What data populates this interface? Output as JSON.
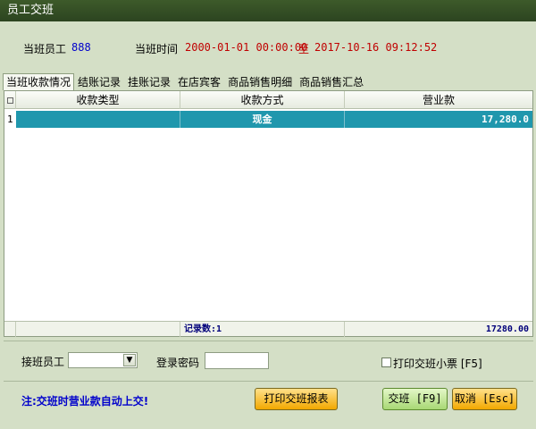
{
  "window": {
    "title": "员工交班"
  },
  "shift": {
    "employee_label": "当班员工",
    "employee_value": "888",
    "time_label": "当班时间",
    "time_start": "2000-01-01 00:00:00",
    "time_to": "至",
    "time_end": "2017-10-16 09:12:52"
  },
  "tabs": [
    {
      "label": "当班收款情况"
    },
    {
      "label": "结账记录"
    },
    {
      "label": "挂账记录"
    },
    {
      "label": "在店宾客"
    },
    {
      "label": "商品销售明细"
    },
    {
      "label": "商品销售汇总"
    }
  ],
  "grid": {
    "columns": [
      "收款类型",
      "收款方式",
      "营业款"
    ],
    "rows": [
      {
        "num": "1",
        "type": "",
        "method": "现金",
        "amount": "17,280.0"
      }
    ],
    "footer": {
      "record_count": "记录数:1",
      "total": "17280.00"
    }
  },
  "handover": {
    "employee_label": "接班员工",
    "employee_value": "",
    "password_label": "登录密码",
    "password_value": "",
    "print_ticket_label": "打印交班小票 [F5]",
    "print_ticket_checked": false
  },
  "note": "注:交班时营业款自动上交!",
  "buttons": {
    "print_report": "打印交班报表",
    "handover": "交班 [F9]",
    "cancel": "取消 [Esc]"
  },
  "colors": {
    "titlebar": "#2c4420",
    "background": "#d4dfc6",
    "selected_row": "#2097ad",
    "employee_value": "#0000cc",
    "time_value": "#c00000",
    "note": "#0000cc",
    "button_orange": "#f2a800",
    "button_green": "#a8d874"
  }
}
